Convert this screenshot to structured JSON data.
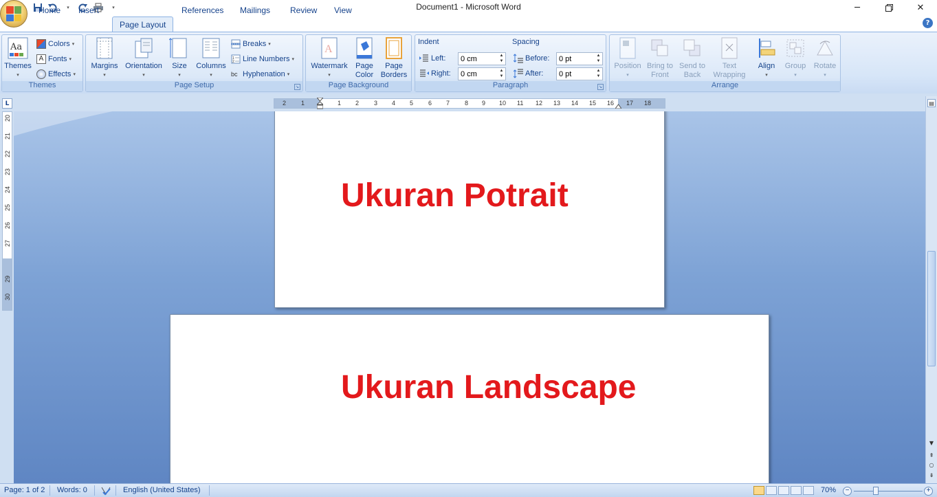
{
  "window": {
    "title": "Document1 - Microsoft Word",
    "minimize_icon": "minimize-icon",
    "restore_icon": "restore-icon",
    "close_icon": "close-icon"
  },
  "quick_access": [
    "save-icon",
    "undo-icon",
    "redo-icon",
    "print-icon",
    "customize-icon"
  ],
  "tabs": [
    {
      "label": "Home"
    },
    {
      "label": "Insert"
    },
    {
      "label": "Page Layout",
      "active": true
    },
    {
      "label": "References"
    },
    {
      "label": "Mailings"
    },
    {
      "label": "Review"
    },
    {
      "label": "View"
    }
  ],
  "ribbon": {
    "themes": {
      "label": "Themes",
      "themes_btn": "Themes",
      "colors": "Colors",
      "fonts": "Fonts",
      "effects": "Effects"
    },
    "page_setup": {
      "label": "Page Setup",
      "margins": "Margins",
      "orientation": "Orientation",
      "size": "Size",
      "columns": "Columns",
      "breaks": "Breaks",
      "line_numbers": "Line Numbers",
      "hyphenation": "Hyphenation"
    },
    "page_background": {
      "label": "Page Background",
      "watermark": "Watermark",
      "page_color_1": "Page",
      "page_color_2": "Color",
      "page_borders_1": "Page",
      "page_borders_2": "Borders"
    },
    "paragraph": {
      "label": "Paragraph",
      "indent_label": "Indent",
      "spacing_label": "Spacing",
      "left_label": "Left:",
      "left_value": "0 cm",
      "right_label": "Right:",
      "right_value": "0 cm",
      "before_label": "Before:",
      "before_value": "0 pt",
      "after_label": "After:",
      "after_value": "0 pt"
    },
    "arrange": {
      "label": "Arrange",
      "position": "Position",
      "bring_front_1": "Bring to",
      "bring_front_2": "Front",
      "send_back_1": "Send to",
      "send_back_2": "Back",
      "text_wrap_1": "Text",
      "text_wrap_2": "Wrapping",
      "align": "Align",
      "group": "Group",
      "rotate": "Rotate"
    }
  },
  "ruler": {
    "h_labels": [
      "2",
      "1",
      "1",
      "2",
      "3",
      "4",
      "5",
      "6",
      "7",
      "8",
      "9",
      "10",
      "11",
      "12",
      "13",
      "14",
      "15",
      "16",
      "17",
      "18"
    ],
    "v_labels": [
      "20",
      "21",
      "22",
      "23",
      "24",
      "25",
      "26",
      "27",
      "29",
      "30"
    ]
  },
  "document": {
    "portrait_text": "Ukuran Potrait",
    "landscape_text": "Ukuran Landscape"
  },
  "status": {
    "page": "Page: 1 of 2",
    "words": "Words: 0",
    "language": "English (United States)",
    "zoom": "70%"
  },
  "colors": {
    "accent_text": "#e3191c",
    "ribbon_blue": "#15428b"
  }
}
